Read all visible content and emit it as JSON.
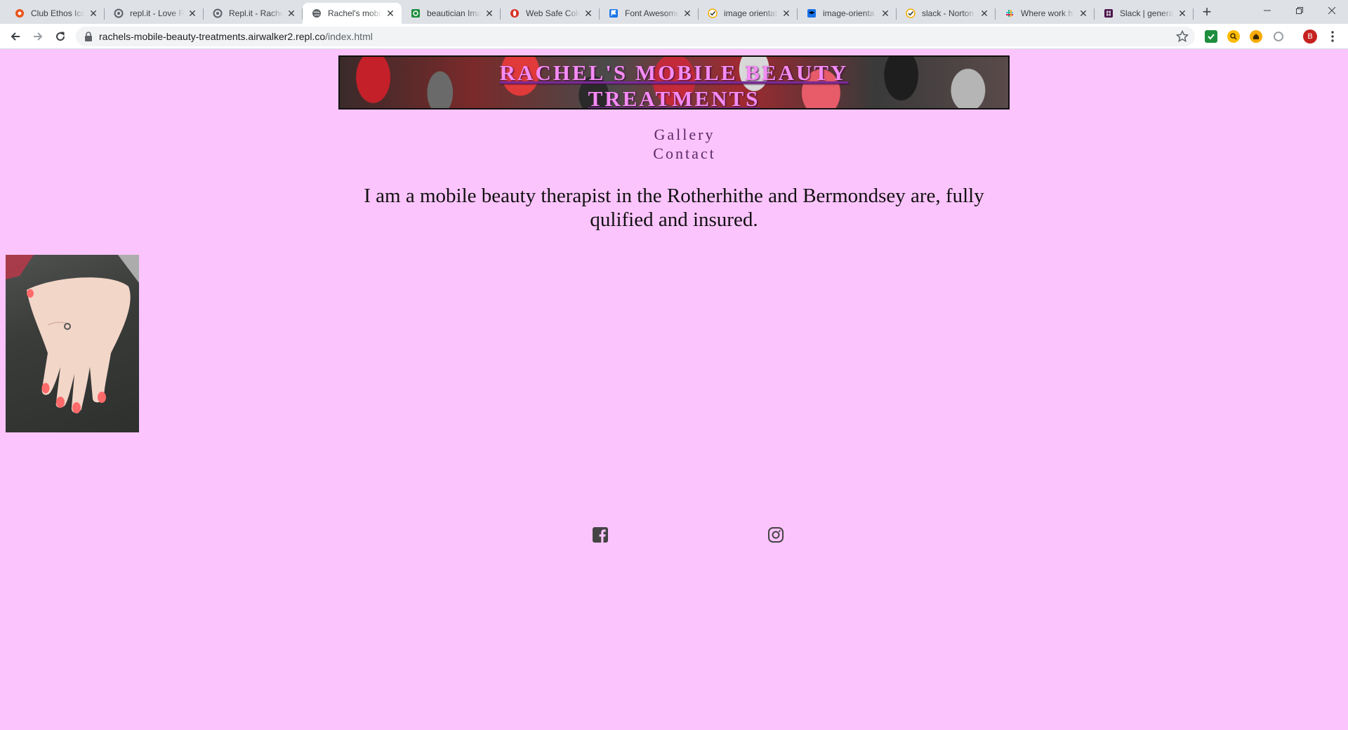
{
  "browser": {
    "tabs": [
      {
        "title": "Club Ethos Icon",
        "icon": "circle-orange-icon",
        "color": "#e8541c"
      },
      {
        "title": "repl.it - Love R",
        "icon": "replit-icon",
        "color": "#5f6368"
      },
      {
        "title": "Repl.it - Rache",
        "icon": "replit-icon",
        "color": "#5f6368"
      },
      {
        "title": "Rachel's mobil",
        "icon": "globe-icon",
        "color": "#5f6368",
        "active": true
      },
      {
        "title": "beautician Ima",
        "icon": "image-search-icon",
        "color": "#1e8e3e"
      },
      {
        "title": "Web Safe Colo",
        "icon": "opera-icon",
        "color": "#d93025"
      },
      {
        "title": "Font Awesome",
        "icon": "flag-icon",
        "color": "#1a73e8"
      },
      {
        "title": "image orientat",
        "icon": "check-badge-icon",
        "color": "#f9ab00"
      },
      {
        "title": "image-orienta",
        "icon": "mortarboard-icon",
        "color": "#1a73e8"
      },
      {
        "title": "slack - Norton",
        "icon": "check-badge-icon",
        "color": "#f9ab00"
      },
      {
        "title": "Where work h",
        "icon": "slack-icon",
        "color": "#e01e5a"
      },
      {
        "title": "Slack | general",
        "icon": "slack-square-icon",
        "color": "#4a154b"
      }
    ],
    "url_host": "rachels-mobile-beauty-treatments.airwalker2.repl.co",
    "url_path": "/index.html",
    "profile_initial": "B"
  },
  "site": {
    "banner_title": "RACHEL'S MOBILE BEAUTY TREATMENTS",
    "nav": {
      "gallery": "Gallery",
      "contact": "Contact"
    },
    "intro": "I am a mobile beauty therapist in the Rotherhithe and Bermondsey are, fully qulified and insured.",
    "social": [
      {
        "icon": "facebook-icon"
      },
      {
        "icon": "instagram-icon"
      }
    ],
    "colors": {
      "background": "#fcc4fc",
      "title": "#f58cf5",
      "nav": "#5a2a6a"
    }
  }
}
